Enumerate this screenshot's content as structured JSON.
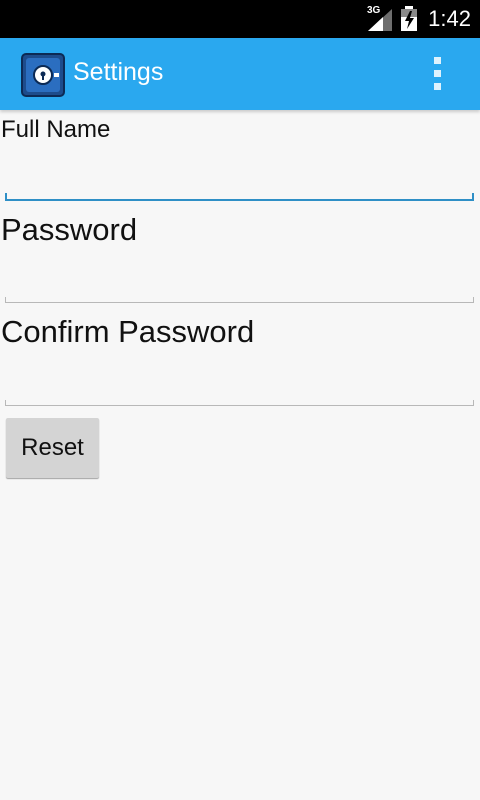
{
  "status_bar": {
    "network_type": "3G",
    "clock": "1:42"
  },
  "action_bar": {
    "app_icon": "lock-app-icon",
    "title": "Settings",
    "overflow_icon": "overflow-menu-icon",
    "background_color": "#2aa8ef"
  },
  "form": {
    "full_name": {
      "label": "Full Name",
      "value": "",
      "focused": true
    },
    "password": {
      "label": "Password",
      "value": ""
    },
    "confirm_password": {
      "label": "Confirm Password",
      "value": ""
    },
    "reset_label": "Reset"
  }
}
